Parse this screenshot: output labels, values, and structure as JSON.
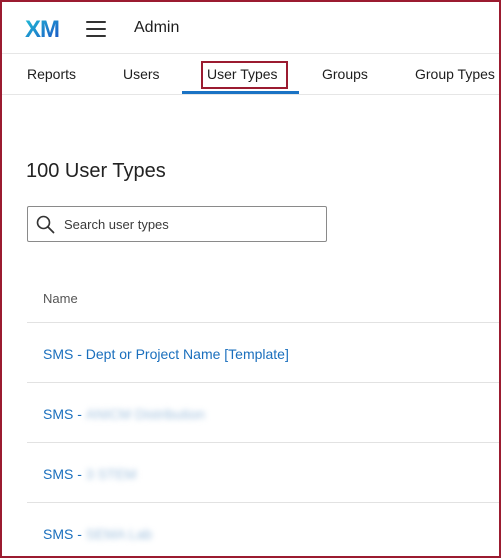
{
  "header": {
    "logo": "XM",
    "menu_icon": "hamburger-menu-icon",
    "title": "Admin"
  },
  "tabs": [
    {
      "label": "Reports",
      "active": false
    },
    {
      "label": "Users",
      "active": false
    },
    {
      "label": "User Types",
      "active": true
    },
    {
      "label": "Groups",
      "active": false
    },
    {
      "label": "Group Types",
      "active": false
    }
  ],
  "colors": {
    "accent": "#1a73c4",
    "link": "#1a6fbd",
    "annotation_border": "#9b1b30"
  },
  "main": {
    "title": "100 User Types",
    "search": {
      "placeholder": "Search user types",
      "value": "",
      "icon": "search-icon"
    },
    "table": {
      "column_header": "Name",
      "rows": [
        {
          "prefix": "SMS - Dept or Project Name [Template]",
          "redacted": ""
        },
        {
          "prefix": "SMS -",
          "redacted": "ANICM Distribution"
        },
        {
          "prefix": "SMS -",
          "redacted": "3 STEM"
        },
        {
          "prefix": "SMS -",
          "redacted": "SEMA Lab"
        }
      ]
    }
  }
}
